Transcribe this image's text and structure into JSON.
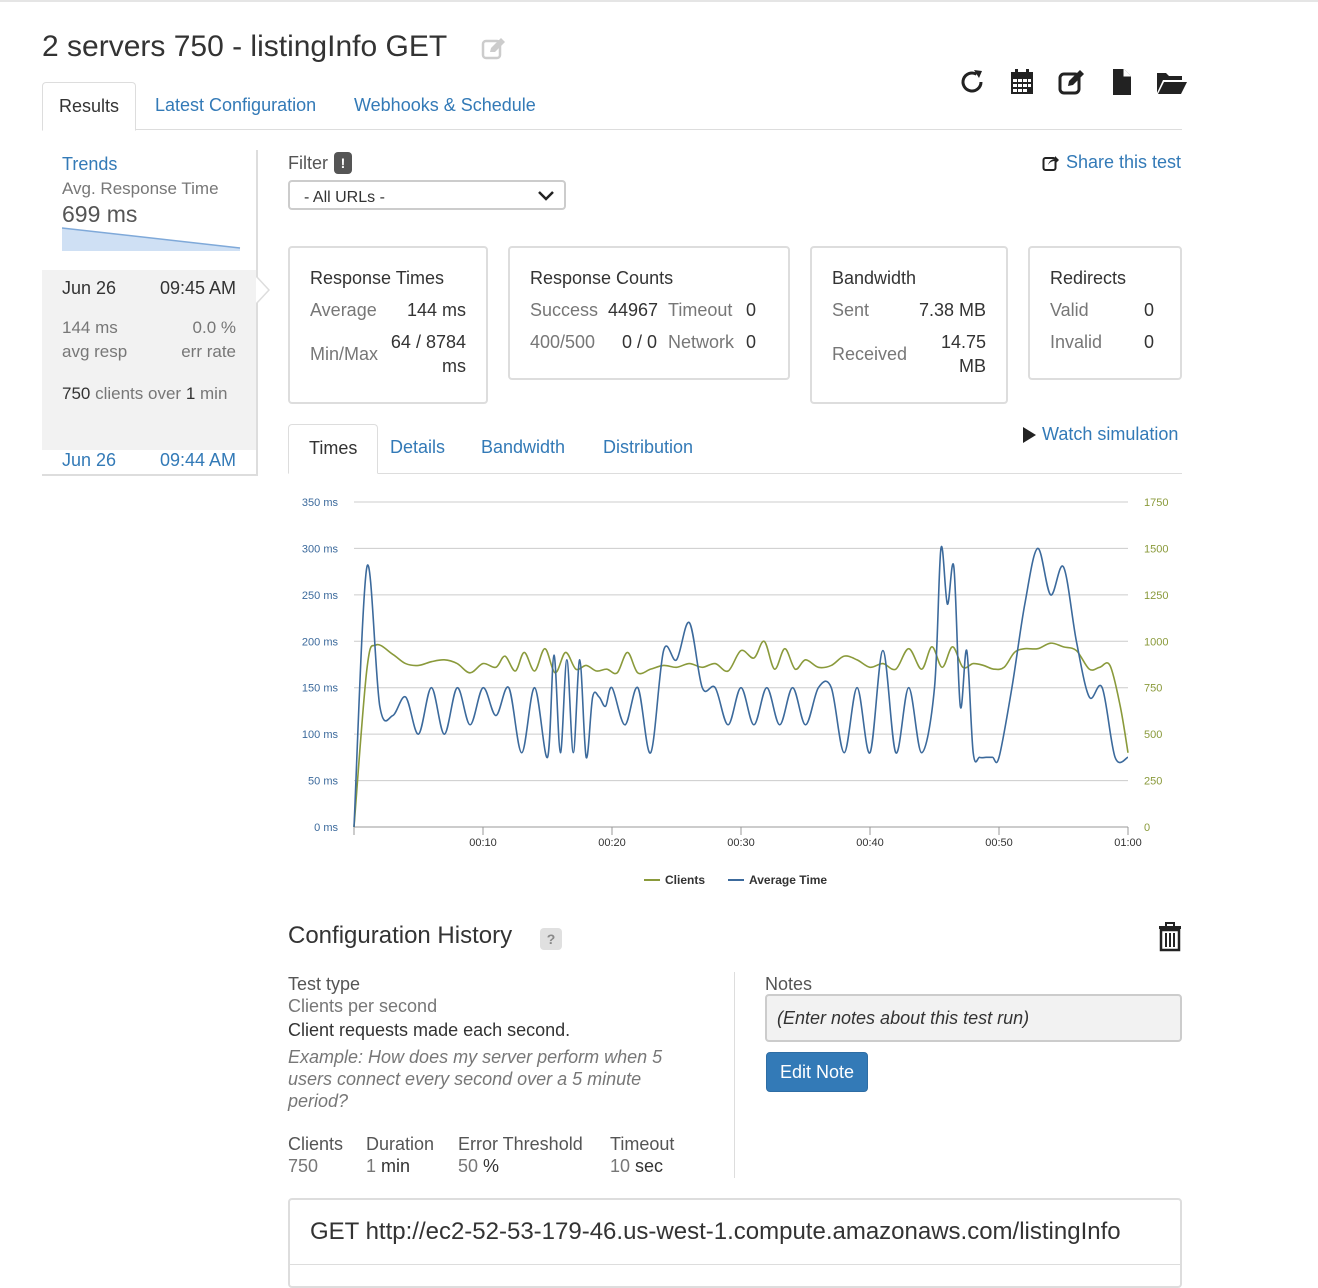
{
  "header": {
    "title": "2 servers 750 - listingInfo GET",
    "toolbar": [
      "refresh-icon",
      "calendar-icon",
      "edit-icon",
      "file-icon",
      "folder-open-icon"
    ]
  },
  "tabs": [
    "Results",
    "Latest Configuration",
    "Webhooks & Schedule"
  ],
  "sidebar": {
    "trends_label": "Trends",
    "avg_label": "Avg. Response Time",
    "avg_value": "699 ms",
    "selected_run": {
      "date": "Jun 26",
      "time": "09:45 AM",
      "avg_resp_value": "144 ms",
      "avg_resp_label": "avg resp",
      "err_rate_value": "0.0 %",
      "err_rate_label": "err rate",
      "clients_count": "750",
      "clients_mid": " clients over ",
      "clients_dur": "1",
      "clients_unit": " min"
    },
    "other_run": {
      "date": "Jun 26",
      "time": "09:44 AM"
    }
  },
  "filter": {
    "label": "Filter",
    "badge": "!",
    "selected": "- All URLs -"
  },
  "share_label": "Share this test",
  "stats": {
    "response_times": {
      "title": "Response Times",
      "avg_label": "Average",
      "avg_value": "144 ms",
      "minmax_label": "Min/Max",
      "minmax_value_1": "64 / 8784",
      "minmax_value_2": "ms"
    },
    "response_counts": {
      "title": "Response Counts",
      "success_label": "Success",
      "success_value": "44967",
      "timeout_label": "Timeout",
      "timeout_value": "0",
      "err_label": "400/500",
      "err_value": "0 / 0",
      "network_label": "Network",
      "network_value": "0"
    },
    "bandwidth": {
      "title": "Bandwidth",
      "sent_label": "Sent",
      "sent_value": "7.38 MB",
      "received_label": "Received",
      "received_value_1": "14.75",
      "received_value_2": "MB"
    },
    "redirects": {
      "title": "Redirects",
      "valid_label": "Valid",
      "valid_value": "0",
      "invalid_label": "Invalid",
      "invalid_value": "0"
    }
  },
  "chart_tabs": [
    "Times",
    "Details",
    "Bandwidth",
    "Distribution"
  ],
  "watch_label": "Watch simulation",
  "chart_data": {
    "type": "line",
    "x_ticks": [
      "00:10",
      "00:20",
      "00:30",
      "00:40",
      "00:50",
      "01:00"
    ],
    "y_left_ticks": [
      "0 ms",
      "50 ms",
      "100 ms",
      "150 ms",
      "200 ms",
      "250 ms",
      "300 ms",
      "350 ms"
    ],
    "y_right_ticks": [
      "0",
      "250",
      "500",
      "750",
      "1000",
      "1250",
      "1500",
      "1750"
    ],
    "ylim_left": [
      0,
      350
    ],
    "ylim_right": [
      0,
      1750
    ],
    "xlim": [
      0,
      60
    ],
    "series": [
      {
        "name": "Clients",
        "axis": "right",
        "color": "#8a9a3b",
        "x": [
          0,
          1,
          1.7,
          3,
          4,
          5,
          6,
          7,
          8,
          9,
          10,
          11,
          11.7,
          12.5,
          13.2,
          14,
          14.8,
          15.6,
          16.4,
          17.2,
          18,
          18.8,
          19.6,
          20.4,
          21.2,
          22,
          23,
          24,
          25,
          26,
          27,
          28,
          29,
          30,
          31,
          31.8,
          32.6,
          33.4,
          34.2,
          35,
          36,
          37,
          38,
          39,
          40,
          41,
          42,
          43,
          44,
          44.8,
          45.6,
          46.4,
          47.2,
          48,
          48.8,
          49.6,
          50.4,
          51.2,
          52,
          53,
          54,
          55,
          56,
          57,
          57.8,
          58.6,
          59.4,
          60
        ],
        "values": [
          0,
          850,
          980,
          930,
          880,
          870,
          890,
          900,
          880,
          830,
          880,
          860,
          920,
          840,
          940,
          840,
          960,
          830,
          940,
          850,
          870,
          840,
          850,
          830,
          940,
          830,
          850,
          870,
          860,
          880,
          860,
          880,
          840,
          950,
          910,
          1000,
          850,
          960,
          850,
          900,
          860,
          870,
          920,
          900,
          860,
          880,
          850,
          960,
          850,
          970,
          860,
          970,
          860,
          880,
          870,
          850,
          860,
          940,
          960,
          960,
          990,
          970,
          950,
          850,
          860,
          870,
          650,
          400
        ]
      },
      {
        "name": "Average Time",
        "axis": "left",
        "color": "#3c6a9c",
        "x": [
          0,
          1,
          2,
          3,
          4,
          5,
          6,
          7,
          8,
          9,
          10,
          11,
          12,
          13,
          14,
          15,
          15.5,
          16,
          16.5,
          17,
          17.5,
          18,
          18.5,
          19,
          19.5,
          20,
          21,
          22,
          23,
          24,
          25,
          26,
          27,
          28,
          29,
          30,
          31,
          32,
          33,
          34,
          35,
          36,
          37,
          38,
          39,
          40,
          41,
          42,
          43,
          44,
          45,
          45.5,
          46,
          46.5,
          47,
          47.5,
          48,
          48.5,
          49,
          49.5,
          50,
          51,
          52,
          53,
          54,
          55,
          56,
          57,
          58,
          59,
          60
        ],
        "values": [
          0,
          280,
          130,
          120,
          140,
          100,
          150,
          100,
          150,
          110,
          150,
          120,
          150,
          80,
          150,
          75,
          185,
          80,
          180,
          80,
          180,
          75,
          140,
          140,
          130,
          150,
          110,
          150,
          80,
          190,
          180,
          220,
          150,
          150,
          110,
          150,
          110,
          150,
          110,
          150,
          110,
          150,
          150,
          80,
          150,
          80,
          190,
          80,
          150,
          80,
          150,
          300,
          240,
          280,
          130,
          190,
          80,
          75,
          75,
          75,
          75,
          150,
          240,
          300,
          250,
          280,
          200,
          140,
          150,
          75,
          75
        ]
      }
    ],
    "legend": "bottom"
  },
  "config_history": {
    "title": "Configuration History",
    "help": "?",
    "test_type_label": "Test type",
    "test_type_value": "Clients per second",
    "description": "Client requests made each second.",
    "example": "Example: How does my server perform when 5 users connect every second over a 5 minute period?",
    "params": {
      "clients_label": "Clients",
      "clients_value": "750",
      "duration_label": "Duration",
      "duration_value": "1",
      "duration_unit": " min",
      "threshold_label": "Error Threshold",
      "threshold_value": "50",
      "threshold_unit": " %",
      "timeout_label": "Timeout",
      "timeout_value": "10",
      "timeout_unit": " sec"
    },
    "notes_label": "Notes",
    "notes_placeholder": "(Enter notes about this test run)",
    "edit_note_label": "Edit Note"
  },
  "request": "GET http://ec2-52-53-179-46.us-west-1.compute.amazonaws.com/listingInfo"
}
